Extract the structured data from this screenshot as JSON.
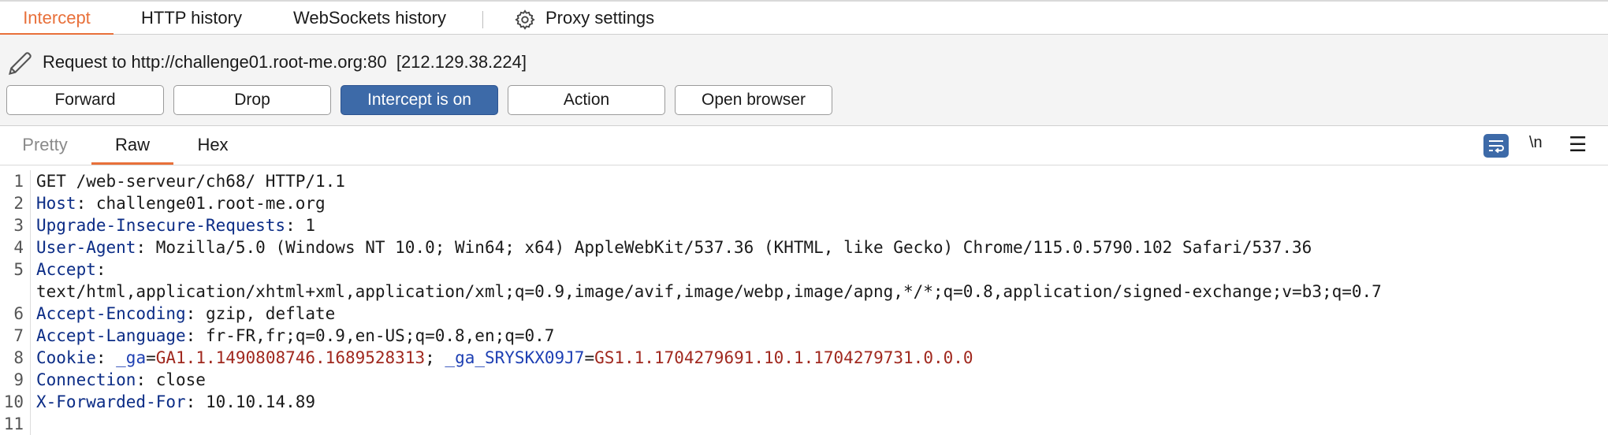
{
  "top_tabs": {
    "intercept": "Intercept",
    "http_history": "HTTP history",
    "websockets_history": "WebSockets history",
    "proxy_settings": "Proxy settings"
  },
  "request": {
    "title": "Request to http://challenge01.root-me.org:80  [212.129.38.224]"
  },
  "buttons": {
    "forward": "Forward",
    "drop": "Drop",
    "intercept": "Intercept is on",
    "action": "Action",
    "open_browser": "Open browser"
  },
  "editor_tabs": {
    "pretty": "Pretty",
    "raw": "Raw",
    "hex": "Hex"
  },
  "tools": {
    "newline": "\\n"
  },
  "line_numbers": [
    "1",
    "2",
    "3",
    "4",
    "5",
    "6",
    "7",
    "8",
    "9",
    "10",
    "11"
  ],
  "http": {
    "request_line": "GET /web-serveur/ch68/ HTTP/1.1",
    "host": {
      "name": "Host",
      "value": ": challenge01.root-me.org"
    },
    "upgrade": {
      "name": "Upgrade-Insecure-Requests",
      "value": ": 1"
    },
    "user_agent": {
      "name": "User-Agent",
      "value": ": Mozilla/5.0 (Windows NT 10.0; Win64; x64) AppleWebKit/537.36 (KHTML, like Gecko) Chrome/115.0.5790.102 Safari/537.36"
    },
    "accept": {
      "name": "Accept",
      "value": ":",
      "cont": "text/html,application/xhtml+xml,application/xml;q=0.9,image/avif,image/webp,image/apng,*/*;q=0.8,application/signed-exchange;v=b3;q=0.7"
    },
    "accept_encoding": {
      "name": "Accept-Encoding",
      "value": ": gzip, deflate"
    },
    "accept_language": {
      "name": "Accept-Language",
      "value": ": fr-FR,fr;q=0.9,en-US;q=0.8,en;q=0.7"
    },
    "cookie": {
      "name": "Cookie",
      "sep0": ": ",
      "k1": "_ga",
      "eq1": "=",
      "v1": "GA1.1.1490808746.1689528313",
      "sep1": "; ",
      "k2": "_ga_SRYSKX09J7",
      "eq2": "=",
      "v2": "GS1.1.1704279691.10.1.1704279731.0.0.0"
    },
    "connection": {
      "name": "Connection",
      "value": ": close"
    },
    "x_forwarded_for": {
      "name": "X-Forwarded-For",
      "value": ": 10.10.14.89"
    }
  },
  "colors": {
    "accent_orange": "#e8703a",
    "button_on_blue": "#3d6aa8",
    "header_name": "#0b2c86",
    "cookie_value": "#a0281e"
  }
}
